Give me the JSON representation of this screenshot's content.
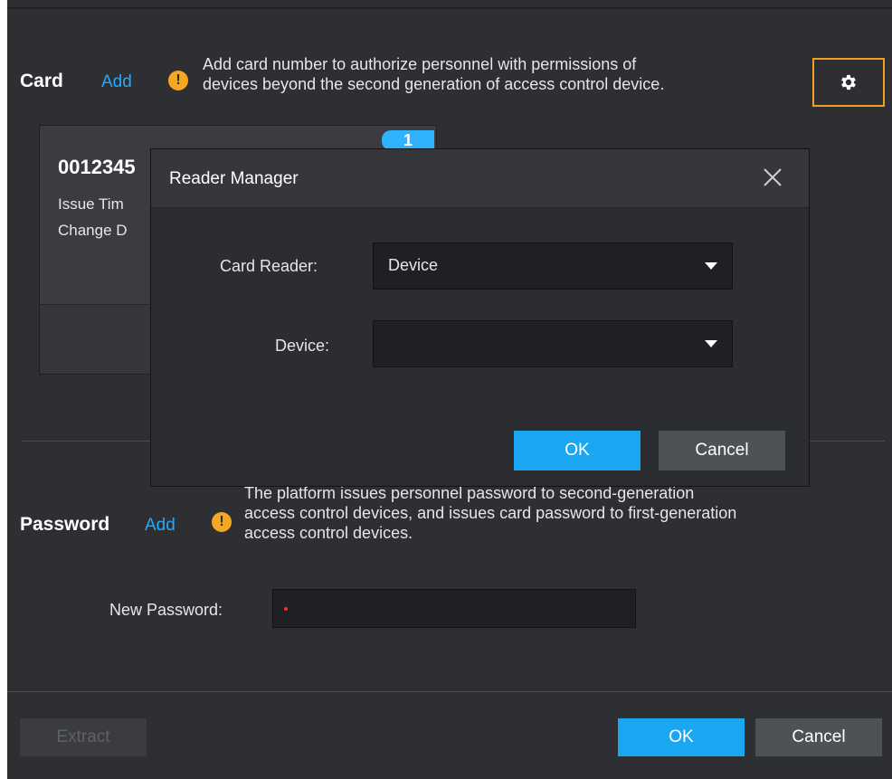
{
  "card": {
    "title": "Card",
    "add_label": "Add",
    "note_line1": "Add card number to authorize personnel with permissions of",
    "note_line2": "devices beyond the second generation of access control device.",
    "badge": "1",
    "number": "0012345",
    "issue_time_label": "Issue Tim",
    "change_label": "Change D",
    "settings_icon": "gear-icon"
  },
  "password": {
    "title": "Password",
    "add_label": "Add",
    "note_line1": "The platform issues personnel password to second-generation",
    "note_line2": "access control devices, and issues card password to first-generation",
    "note_line3": "access control devices.",
    "new_password_label": "New Password:",
    "new_password_value": ""
  },
  "footer": {
    "extract_label": "Extract",
    "ok_label": "OK",
    "cancel_label": "Cancel"
  },
  "modal": {
    "title": "Reader Manager",
    "card_reader_label": "Card Reader:",
    "card_reader_value": "Device",
    "device_label": "Device:",
    "device_value": "",
    "ok_label": "OK",
    "cancel_label": "Cancel"
  },
  "colors": {
    "panel_bg": "#2d2f33",
    "accent_blue": "#1aa6f0",
    "link_blue": "#26a8ff",
    "warning_orange": "#f5a623",
    "focus_orange": "#f0a020"
  }
}
